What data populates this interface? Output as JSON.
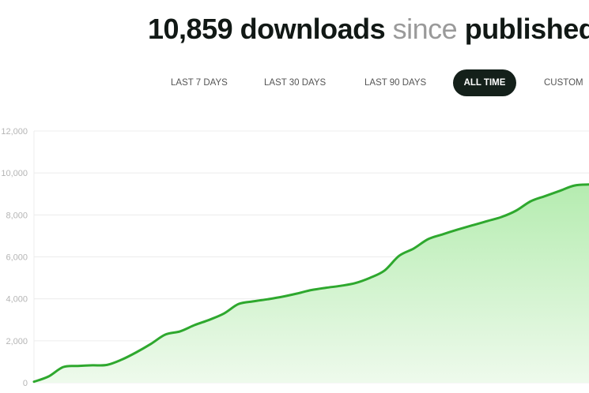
{
  "header": {
    "count": "10,859",
    "word_downloads": "downloads",
    "word_since": "since",
    "word_published": "published"
  },
  "tabs": [
    {
      "label": "LAST 7 DAYS",
      "active": false
    },
    {
      "label": "LAST 30 DAYS",
      "active": false
    },
    {
      "label": "LAST 90 DAYS",
      "active": false
    },
    {
      "label": "ALL TIME",
      "active": true
    },
    {
      "label": "CUSTOM",
      "active": false
    }
  ],
  "colors": {
    "line": "#2ea82e",
    "fill_top": "#b5ecb0",
    "fill_bottom": "#eefaec",
    "grid": "#ececec",
    "active_tab_bg": "#14201a"
  },
  "chart_data": {
    "type": "area",
    "title": "",
    "xlabel": "",
    "ylabel": "",
    "ylim": [
      0,
      12000
    ],
    "yticks": [
      0,
      2000,
      4000,
      6000,
      8000,
      10000,
      12000
    ],
    "ytick_labels": [
      "0",
      "2,000",
      "4,000",
      "6,000",
      "8,000",
      "10,000",
      "12,000"
    ],
    "grid": true,
    "x": [
      0,
      1,
      2,
      3,
      4,
      5,
      6,
      7,
      8,
      9,
      10,
      11,
      12,
      13,
      14,
      15,
      16,
      17,
      18,
      19,
      20,
      21,
      22,
      23,
      24,
      25,
      26,
      27,
      28,
      29,
      30,
      31,
      32,
      33,
      34,
      35,
      36,
      37,
      38
    ],
    "series": [
      {
        "values": [
          50,
          300,
          750,
          800,
          830,
          850,
          1100,
          1450,
          1850,
          2300,
          2450,
          2750,
          3000,
          3300,
          3750,
          3880,
          3980,
          4100,
          4250,
          4420,
          4530,
          4620,
          4750,
          5000,
          5350,
          6050,
          6400,
          6850,
          7080,
          7300,
          7500,
          7700,
          7900,
          8200,
          8650,
          8900,
          9150,
          9400,
          9450
        ]
      }
    ]
  }
}
